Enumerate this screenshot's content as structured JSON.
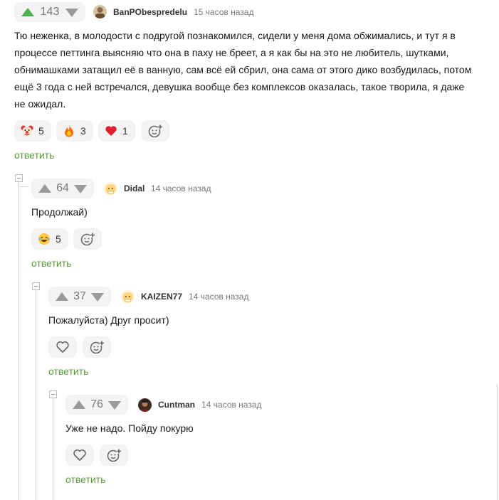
{
  "comments": [
    {
      "rating": "143",
      "author": "BanPObespredelu",
      "time": "15 часов назад",
      "text_lines": [
        "Тю неженка, в молодости с подругой познакомился, сидели у меня дома обжимались, и тут я в",
        "процессе петтинга выясняю что она в паху не бреет, а я как бы на это не любитель, шутками,",
        "обнимашками затащил её в ванную, сам всё ей сбрил, она сама от этого дико возбудилась, потом",
        "ещё 3 года с ней встречался, девушка вообще без комплексов оказалась, такое творила, я даже",
        "не ожидал."
      ],
      "reactions": [
        {
          "icon": "clown-emoji-icon",
          "count": "5"
        },
        {
          "icon": "fire-emoji-icon",
          "count": "3"
        },
        {
          "icon": "heart-emoji-icon",
          "count": "1"
        }
      ],
      "reply_label": "ответить"
    },
    {
      "rating": "64",
      "author": "Didal",
      "time": "14 часов назад",
      "text": "Продолжай)",
      "reactions": [
        {
          "icon": "laughing-emoji-icon",
          "count": "5"
        }
      ],
      "reply_label": "ответить"
    },
    {
      "rating": "37",
      "author": "KAIZEN77",
      "time": "14 часов назад",
      "text": "Пожалуйста) Друг просит)",
      "reply_label": "ответить"
    },
    {
      "rating": "76",
      "author": "Cuntman",
      "time": "14 часов назад",
      "text": "Уже не надо. Пойду покурю",
      "reply_label": "ответить"
    }
  ],
  "colors": {
    "upvote_active": "#4caf50",
    "upvote_inactive": "#9a9a9a",
    "reply_link": "#5b9e3c",
    "pill_bg": "#f3f3f3"
  }
}
